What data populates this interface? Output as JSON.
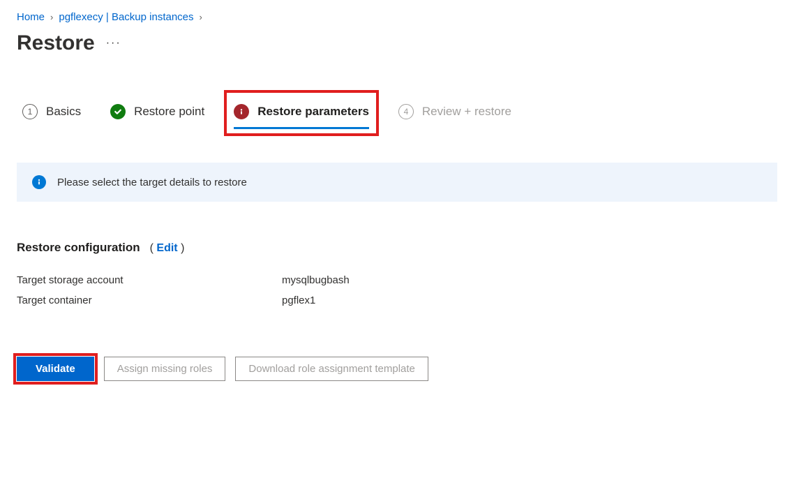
{
  "breadcrumb": {
    "home": "Home",
    "instances": "pgflexecy | Backup instances"
  },
  "page": {
    "title": "Restore"
  },
  "tabs": {
    "basics": "Basics",
    "restore_point": "Restore point",
    "restore_parameters": "Restore parameters",
    "review": "Review + restore",
    "step1": "1",
    "step4": "4"
  },
  "banner": {
    "text": "Please select the target details to restore"
  },
  "section": {
    "title": "Restore configuration",
    "edit_link": "Edit"
  },
  "details": {
    "storage_label": "Target storage account",
    "storage_value": "mysqlbugbash",
    "container_label": "Target container",
    "container_value": "pgflex1"
  },
  "actions": {
    "validate": "Validate",
    "assign_roles": "Assign missing roles",
    "download_template": "Download role assignment template"
  }
}
